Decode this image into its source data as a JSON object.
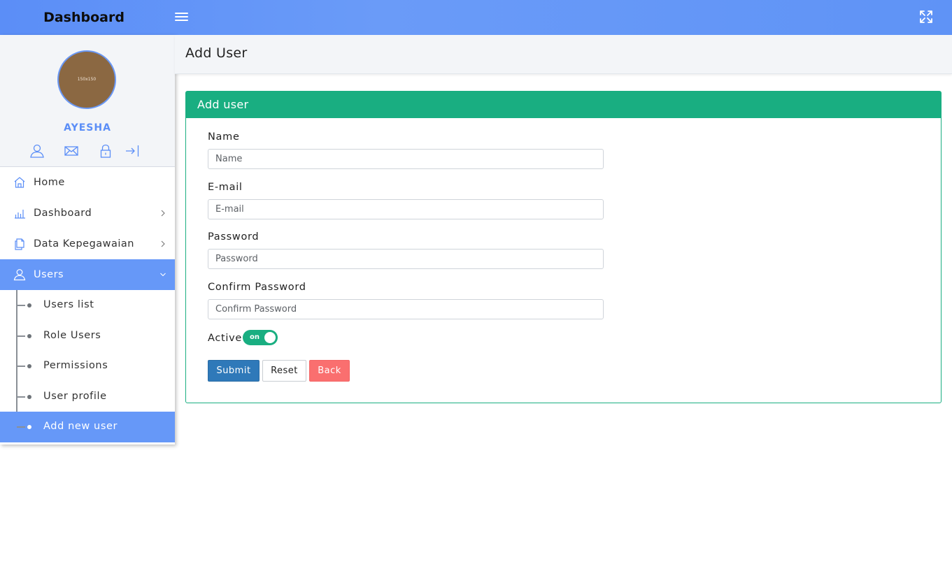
{
  "topbar": {
    "brand": "Dashboard",
    "menu_icon": "hamburger-icon",
    "expand_icon": "fullscreen-icon"
  },
  "sidebar": {
    "avatar_text": "150x150",
    "username": "AYESHA",
    "quick_icons": [
      "user-icon",
      "mail-icon",
      "lock-icon",
      "logout-icon"
    ],
    "menu": [
      {
        "label": "Home",
        "icon": "home-icon"
      },
      {
        "label": "Dashboard",
        "icon": "bar-chart-icon"
      },
      {
        "label": "Data Kepegawaian",
        "icon": "documents-icon"
      },
      {
        "label": "Users",
        "icon": "user-icon"
      }
    ],
    "users_submenu": [
      {
        "label": "Users list"
      },
      {
        "label": "Role Users"
      },
      {
        "label": "Permissions"
      },
      {
        "label": "User profile"
      },
      {
        "label": "Add new user"
      }
    ]
  },
  "page": {
    "title": "Add User"
  },
  "form": {
    "header": "Add user",
    "name": {
      "label": "Name",
      "placeholder": "Name",
      "value": ""
    },
    "email": {
      "label": "E-mail",
      "placeholder": "E-mail",
      "value": ""
    },
    "password": {
      "label": "Password",
      "placeholder": "Password",
      "value": ""
    },
    "confirm_password": {
      "label": "Confirm Password",
      "placeholder": "Confirm Password",
      "value": ""
    },
    "active": {
      "label": "Active",
      "toggle_text": "on",
      "state": true
    },
    "buttons": {
      "submit": "Submit",
      "reset": "Reset",
      "back": "Back"
    }
  },
  "colors": {
    "topbar": "#5b8ef7",
    "sidebar_active": "#6698f8",
    "card_accent": "#19ae81",
    "submit": "#2f79b9",
    "back": "#fa6f6f"
  }
}
